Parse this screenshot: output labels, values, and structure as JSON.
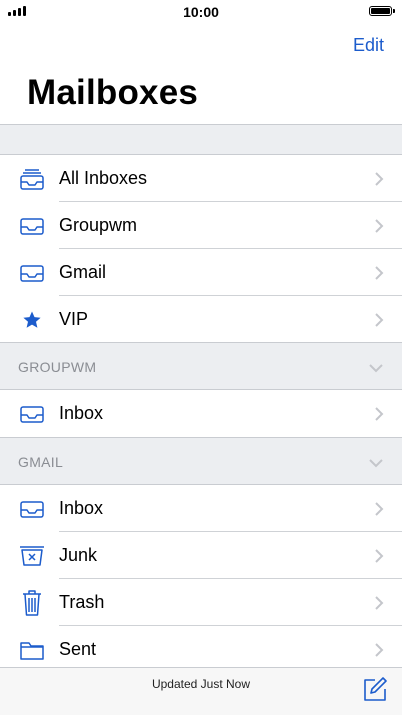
{
  "status_bar": {
    "time": "10:00"
  },
  "nav": {
    "edit_label": "Edit",
    "title": "Mailboxes"
  },
  "main_rows": [
    {
      "label": "All Inboxes",
      "icon": "all-inboxes-icon"
    },
    {
      "label": "Groupwm",
      "icon": "inbox-tray-icon"
    },
    {
      "label": "Gmail",
      "icon": "inbox-tray-icon"
    },
    {
      "label": "VIP",
      "icon": "star-icon"
    }
  ],
  "sections": [
    {
      "header": "GROUPWM",
      "rows": [
        {
          "label": "Inbox",
          "icon": "inbox-tray-icon"
        }
      ]
    },
    {
      "header": "GMAIL",
      "rows": [
        {
          "label": "Inbox",
          "icon": "inbox-tray-icon"
        },
        {
          "label": "Junk",
          "icon": "junk-tray-icon"
        },
        {
          "label": "Trash",
          "icon": "trash-icon"
        },
        {
          "label": "Sent",
          "icon": "folder-icon"
        }
      ]
    }
  ],
  "footer": {
    "status": "Updated Just Now",
    "compose_icon": "compose-icon"
  },
  "colors": {
    "accent": "#1c5ccc",
    "grouped_bg": "#eceef1",
    "chevron": "#c4c6cb",
    "section_text": "#8a8d93"
  }
}
